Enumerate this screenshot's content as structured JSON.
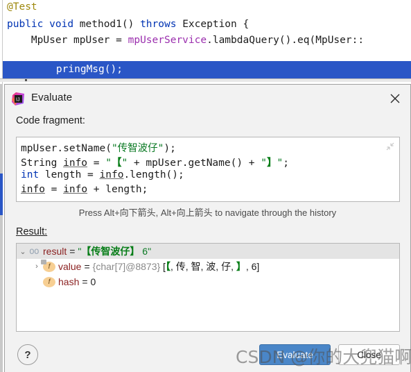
{
  "editor": {
    "lines": [
      {
        "id": "l1",
        "tokens": [
          {
            "t": "@Test",
            "c": "anno"
          }
        ]
      },
      {
        "id": "l2",
        "tokens": [
          {
            "t": "public",
            "c": "kw"
          },
          {
            "t": " ",
            "c": "plain"
          },
          {
            "t": "void",
            "c": "kw"
          },
          {
            "t": " method1() ",
            "c": "plain"
          },
          {
            "t": "throws",
            "c": "kw"
          },
          {
            "t": " Exception {",
            "c": "plain"
          }
        ]
      },
      {
        "id": "l3",
        "tokens": [
          {
            "t": "    MpUser mpUser = ",
            "c": "plain"
          },
          {
            "t": "mpUserService",
            "c": "field"
          },
          {
            "t": ".lambdaQuery().eq(MpUser::",
            "c": "plain"
          }
        ]
      }
    ],
    "highlighted_line": "    pringMsg();"
  },
  "dialog": {
    "icon": "intellij-idea-logo",
    "title": "Evaluate",
    "close_label": "✕",
    "code_fragment_label": "Code fragment:",
    "code_fragment": {
      "lines": [
        {
          "id": "c1",
          "tokens": [
            {
              "t": "mpUser.setName(",
              "c": "plain"
            },
            {
              "t": "\"传智波仔\"",
              "c": "str"
            },
            {
              "t": ");",
              "c": "plain"
            }
          ]
        },
        {
          "id": "c2",
          "tokens": [
            {
              "t": "String ",
              "c": "plain"
            },
            {
              "t": "info",
              "c": "plain ul"
            },
            {
              "t": " = ",
              "c": "plain"
            },
            {
              "t": "\"",
              "c": "str"
            },
            {
              "t": "【",
              "c": "brk"
            },
            {
              "t": "\"",
              "c": "str"
            },
            {
              "t": " + mpUser.getName() + ",
              "c": "plain"
            },
            {
              "t": "\"",
              "c": "str"
            },
            {
              "t": "】",
              "c": "brk"
            },
            {
              "t": "\"",
              "c": "str"
            },
            {
              "t": ";",
              "c": "plain"
            }
          ]
        },
        {
          "id": "c3",
          "tokens": [
            {
              "t": "int",
              "c": "kw"
            },
            {
              "t": " length = ",
              "c": "plain"
            },
            {
              "t": "info",
              "c": "plain ul"
            },
            {
              "t": ".length();",
              "c": "plain"
            }
          ]
        },
        {
          "id": "c4",
          "tokens": [
            {
              "t": "info",
              "c": "plain ul"
            },
            {
              "t": " = ",
              "c": "plain"
            },
            {
              "t": "info",
              "c": "plain ul"
            },
            {
              "t": " + length;",
              "c": "plain"
            }
          ]
        }
      ],
      "collapse_icon": "collapse-arrows-icon"
    },
    "hint": "Press Alt+向下箭头, Alt+向上箭头 to navigate through the history",
    "result_label": "Result:",
    "result_tree": [
      {
        "id": "r0",
        "indent": 0,
        "twisty": "⌄",
        "expanded": true,
        "selected": true,
        "icon": "object-result-icon",
        "icon_glyph": "oo",
        "name": "result",
        "eq": "=",
        "value_parts": [
          {
            "t": "\"",
            "c": "valq"
          },
          {
            "t": "【传智波仔】",
            "c": "valbr"
          },
          {
            "t": " 6",
            "c": "valq"
          },
          {
            "t": "\"",
            "c": "valq"
          }
        ]
      },
      {
        "id": "r1",
        "indent": 1,
        "twisty": "›",
        "expanded": false,
        "selected": false,
        "icon": "field-icon-shadowed",
        "icon_glyph": "f",
        "name": "value",
        "eq": "=",
        "value_parts": [
          {
            "t": "{char[7]@8873}",
            "c": "grey"
          },
          {
            "t": " [",
            "c": "dark"
          },
          {
            "t": "【",
            "c": "valbr"
          },
          {
            "t": ", 传, 智, 波, 仔, ",
            "c": "dark"
          },
          {
            "t": "】",
            "c": "valbr"
          },
          {
            "t": ", 6]",
            "c": "dark"
          }
        ]
      },
      {
        "id": "r2",
        "indent": 1,
        "twisty": "",
        "expanded": false,
        "selected": false,
        "icon": "field-icon",
        "icon_glyph": "f",
        "name": "hash",
        "eq": "=",
        "value_parts": [
          {
            "t": "0",
            "c": "dark"
          }
        ]
      }
    ],
    "footer": {
      "help_label": "?",
      "evaluate_label": "Evaluate",
      "close_label": "Close"
    }
  },
  "watermark": "CSDN @你的大兜猫啊",
  "colors": {
    "accent_blue": "#2a56c6",
    "primary_button": "#4a86c8",
    "string_green": "#0b7a24",
    "keyword_blue": "#0033b3",
    "field_purple": "#9b2fae",
    "name_red": "#8a1f1f",
    "field_icon": "#f7cf93"
  }
}
